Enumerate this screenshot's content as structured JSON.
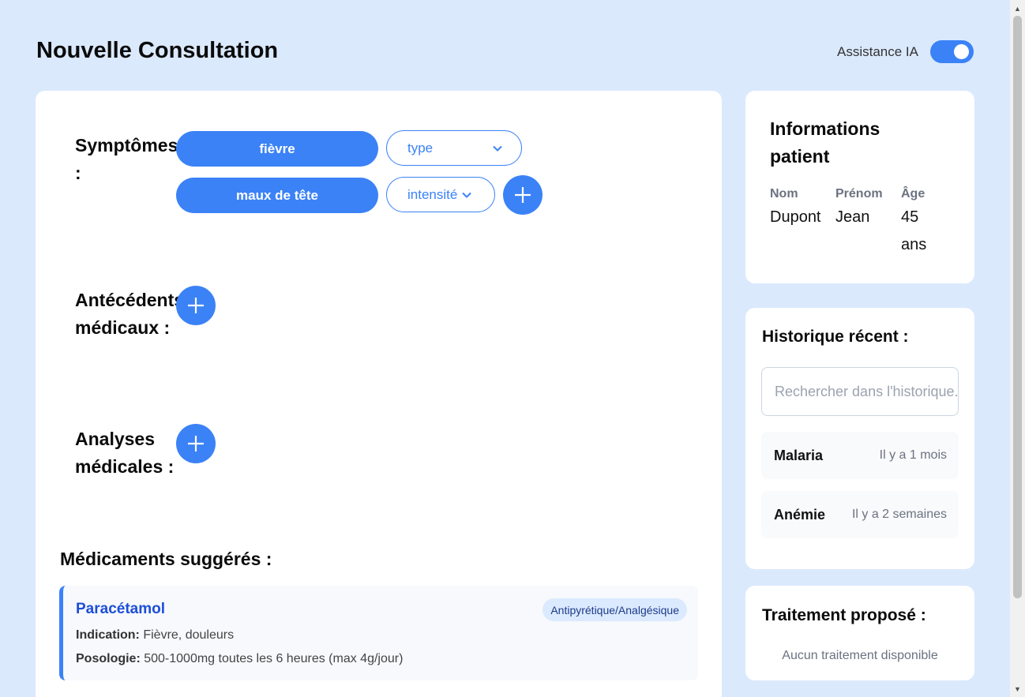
{
  "header": {
    "title": "Nouvelle Consultation",
    "ai_label": "Assistance IA",
    "ai_enabled": true
  },
  "symptoms": {
    "label": "Symptômes :",
    "items": [
      {
        "name": "fièvre",
        "attribute": "type"
      },
      {
        "name": "maux de tête",
        "attribute": "intensité"
      }
    ]
  },
  "antecedents": {
    "label": "Antécédents médicaux :"
  },
  "analyses": {
    "label": "Analyses médicales :"
  },
  "medications": {
    "title": "Médicaments suggérés :",
    "items": [
      {
        "name": "Paracétamol",
        "category": "Antipyrétique/Analgésique",
        "indication_label": "Indication:",
        "indication": "Fièvre, douleurs",
        "posologie_label": "Posologie:",
        "posologie": "500-1000mg toutes les 6 heures (max 4g/jour)"
      }
    ]
  },
  "patient": {
    "title": "Informations patient",
    "fields": [
      {
        "label": "Nom",
        "value": "Dupont"
      },
      {
        "label": "Prénom",
        "value": "Jean"
      },
      {
        "label": "Âge",
        "value": "45 ans"
      }
    ]
  },
  "history": {
    "title": "Historique récent :",
    "search_placeholder": "Rechercher dans l'historique...",
    "items": [
      {
        "name": "Malaria",
        "when": "Il y a 1 mois"
      },
      {
        "name": "Anémie",
        "when": "Il y a 2 semaines"
      }
    ]
  },
  "treatment": {
    "title": "Traitement proposé :",
    "empty": "Aucun traitement disponible"
  },
  "colors": {
    "accent": "#3b82f6",
    "background": "#dbe9fd"
  },
  "icons": {
    "plus": "plus-icon",
    "chevron": "chevron-down-icon"
  }
}
